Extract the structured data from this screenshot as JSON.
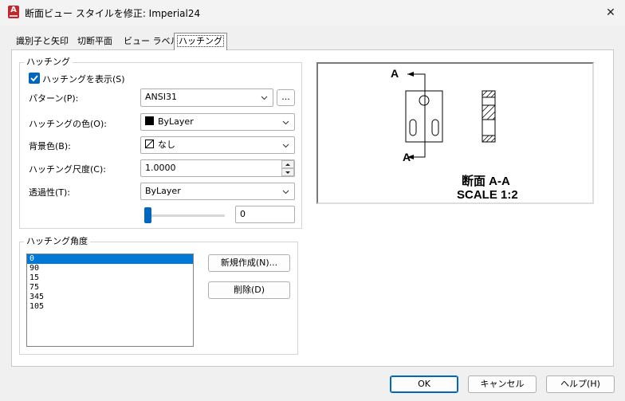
{
  "window": {
    "title": "断面ビュー スタイルを修正: Imperial24",
    "app_icon_letter": "A",
    "close_glyph": "✕"
  },
  "tabs": [
    {
      "label": "識別子と矢印",
      "active": false
    },
    {
      "label": "切断平面",
      "active": false
    },
    {
      "label": "ビュー ラベル",
      "active": false
    },
    {
      "label": "ハッチング",
      "active": true
    }
  ],
  "hatch": {
    "group_title": "ハッチング",
    "show_hatch": {
      "label": "ハッチングを表示(S)",
      "checked": true
    },
    "pattern": {
      "label": "パターン(P):",
      "value": "ANSI31",
      "browse": "..."
    },
    "color": {
      "label": "ハッチングの色(O):",
      "value": "ByLayer",
      "swatch": "#000000"
    },
    "background": {
      "label": "背景色(B):",
      "value": "なし"
    },
    "scale": {
      "label": "ハッチング尺度(C):",
      "value": "1.0000"
    },
    "transparency": {
      "label": "透過性(T):",
      "value": "ByLayer",
      "slider_value": "0",
      "slider_fraction": 0
    }
  },
  "angles": {
    "group_title": "ハッチング角度",
    "items": [
      "0",
      "90",
      "15",
      "75",
      "345",
      "105"
    ],
    "selected_index": 0,
    "new_button": "新規作成(N)...",
    "delete_button": "削除(D)"
  },
  "preview": {
    "marker_top": "A",
    "marker_bottom": "A",
    "section_title": "断面 A-A",
    "scale_label": "SCALE 1:2"
  },
  "footer": {
    "ok": "OK",
    "cancel": "キャンセル",
    "help": "ヘルプ(H)"
  },
  "colors": {
    "accent": "#0067c0",
    "selection": "#0078d7",
    "app_icon": "#c4262e"
  }
}
